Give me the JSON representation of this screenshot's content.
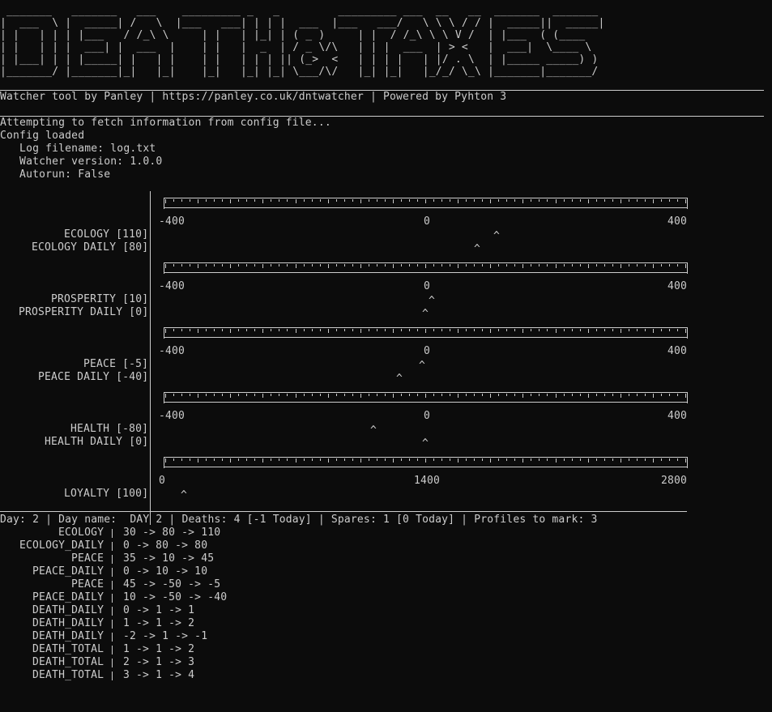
{
  "banner": [
    " _______   _______   ___    _________ _   _         _________ ___  __   __  _______  _______ ",
    "|  ___  \\ |  _____| /   \\  |___   ___| | | |  ___  |___   ___/   \\ \\ \\ / / |  _____||  _____|",
    "| |   | | | |___   / /_\\ \\     | |   | |_| | ( _ )     | |  / /_\\ \\ \\ V /  | |___  ( (____ ",
    "| |   | | |  ___| |  ___  |    | |   |  _  | / _ \\/\\   | | |  ___  | > <   |  ___|  \\____ \\",
    "| |___| | | |_____| |   | |    | |   | | | || (_>  <   | | | |   | |/ . \\  | |_____ _____) )",
    "|_______/ |_______|_|   |_|    |_|   |_| |_| \\___/\\/   |_| |_|   |_/_/ \\_\\ |_______|_______/ "
  ],
  "header_line": "Watcher tool by Panley | https://panley.co.uk/dntwatcher | Powered by Pyhton 3",
  "config": {
    "fetching": "Attempting to fetch information from config file...",
    "loaded": "Config loaded",
    "log_filename": "   Log filename: log.txt",
    "watcher_version": "   Watcher version: 1.0.0",
    "autorun": "   Autorun: False"
  },
  "charts": [
    {
      "id": "ecology",
      "axis_labels": [
        "-400",
        "0",
        "400"
      ],
      "axis": [
        -400,
        400
      ],
      "rows": [
        {
          "label": "ECOLOGY [110]",
          "value": 110
        },
        {
          "label": "ECOLOGY DAILY [80]",
          "value": 80
        }
      ]
    },
    {
      "id": "prosperity",
      "axis_labels": [
        "-400",
        "0",
        "400"
      ],
      "axis": [
        -400,
        400
      ],
      "rows": [
        {
          "label": "PROSPERITY [10]",
          "value": 10
        },
        {
          "label": "PROSPERITY DAILY [0]",
          "value": 0
        }
      ]
    },
    {
      "id": "peace",
      "axis_labels": [
        "-400",
        "0",
        "400"
      ],
      "axis": [
        -400,
        400
      ],
      "rows": [
        {
          "label": "PEACE [-5]",
          "value": -5
        },
        {
          "label": "PEACE DAILY [-40]",
          "value": -40
        }
      ]
    },
    {
      "id": "health",
      "axis_labels": [
        "-400",
        "0",
        "400"
      ],
      "axis": [
        -400,
        400
      ],
      "rows": [
        {
          "label": "HEALTH [-80]",
          "value": -80
        },
        {
          "label": "HEALTH DAILY [0]",
          "value": 0
        }
      ]
    },
    {
      "id": "loyalty",
      "axis_labels": [
        "0",
        "1400",
        "2800"
      ],
      "axis": [
        0,
        2800
      ],
      "rows": [
        {
          "label": "LOYALTY [100]",
          "value": 100
        }
      ]
    }
  ],
  "marker": "^",
  "status_line": "Day: 2 | Day name:  DAY 2 | Deaths: 4 [-1 Today] | Spares: 1 [0 Today] | Profiles to mark: 3",
  "changes": [
    {
      "name": "ECOLOGY",
      "values": "30 -> 80 -> 110"
    },
    {
      "name": "ECOLOGY_DAILY",
      "values": "0 -> 80 -> 80"
    },
    {
      "name": "PEACE",
      "values": "35 -> 10 -> 45"
    },
    {
      "name": "PEACE_DAILY",
      "values": "0 -> 10 -> 10"
    },
    {
      "name": "PEACE",
      "values": "45 -> -50 -> -5"
    },
    {
      "name": "PEACE_DAILY",
      "values": "10 -> -50 -> -40"
    },
    {
      "name": "DEATH_DAILY",
      "values": "0 -> 1 -> 1"
    },
    {
      "name": "DEATH_DAILY",
      "values": "1 -> 1 -> 2"
    },
    {
      "name": "DEATH_DAILY",
      "values": "-2 -> 1 -> -1"
    },
    {
      "name": "DEATH_TOTAL",
      "values": "1 -> 1 -> 2"
    },
    {
      "name": "DEATH_TOTAL",
      "values": "2 -> 1 -> 3"
    },
    {
      "name": "DEATH_TOTAL",
      "values": "3 -> 1 -> 4"
    }
  ],
  "colors": {
    "background": "#0c0c0c",
    "text": "#cccccc"
  }
}
